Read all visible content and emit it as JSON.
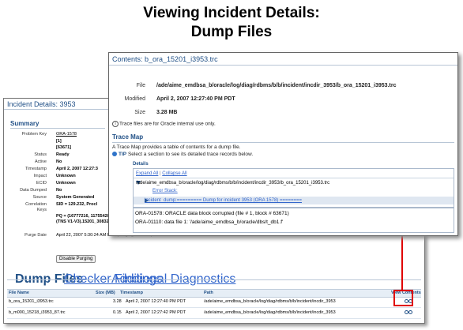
{
  "slide": {
    "title_line1": "Viewing Incident Details:",
    "title_line2": "Dump Files"
  },
  "incident": {
    "title": "Incident Details: 3953",
    "summary_heading": "Summary",
    "fields": [
      {
        "label": "Problem Key",
        "value": "ORA-1578",
        "style": "link"
      },
      {
        "label": "",
        "value": "[1]",
        "style": "bold"
      },
      {
        "label": "",
        "value": "[63671]",
        "style": "bold"
      },
      {
        "label": "Status",
        "value": "Ready",
        "style": "bold"
      },
      {
        "label": "Active",
        "value": "No",
        "style": "bold"
      },
      {
        "label": "Timestamp",
        "value": "April 2, 2007 12:27:3",
        "style": "bold"
      },
      {
        "label": "Impact",
        "value": "Unknown",
        "style": "bold"
      },
      {
        "label": "ECID",
        "value": "Unknown",
        "style": "bold"
      },
      {
        "label": "Data Dumped",
        "value": "No",
        "style": "bold"
      },
      {
        "label": "Source",
        "value": "System Generated",
        "style": "bold"
      },
      {
        "label": "Correlation",
        "value": "SID = 129.232, ProcI",
        "style": "bold"
      },
      {
        "label": "Keys",
        "value": "",
        "style": "plain"
      },
      {
        "label": "",
        "value": "PQ = (16777216, 1175542056), Client ProcId = oracle@stacg17",
        "style": "bold"
      },
      {
        "label": "",
        "value": "(TNS V1-V3).15201_3083220672",
        "style": "bold"
      },
      {
        "label": "Purge Date",
        "value": "April 22, 2007 5:30:24 AM PDT (Purging Enabled)",
        "style": "plain"
      }
    ],
    "disable_purging_label": "Disable Purging",
    "tabs": [
      "Dump Files",
      "Checker Findings",
      "Additional Diagnostics"
    ],
    "active_tab": "Dump Files",
    "table": {
      "headers": [
        "File Name",
        "Size (MB)",
        "Timestamp",
        "Path",
        "View Contents"
      ],
      "rows": [
        {
          "file": "b_ora_15201_i3953.trc",
          "size": "3.28",
          "timestamp": "April 2, 2007 12:27:40 PM PDT",
          "path": "/ade/aime_emdbsa_b/oracle/log/diag/rdbms/b/b/incident/incdir_3953",
          "view_icon": "glasses-icon"
        },
        {
          "file": "b_m000_15218_i3953_87.trc",
          "size": "0.15",
          "timestamp": "April 2, 2007 12:27:42 PM PDT",
          "path": "/ade/aime_emdbsa_b/oracle/log/diag/rdbms/b/b/incident/incdir_3953",
          "view_icon": "glasses-icon"
        }
      ]
    }
  },
  "contents": {
    "title": "Contents: b_ora_15201_i3953.trc",
    "file_label": "File",
    "file_value": "/ade/aime_emdbsa_b/oracle/log/diag/rdbms/b/b/incident/incdir_3953/b_ora_15201_i3953.trc",
    "modified_label": "Modified",
    "modified_value": "April 2, 2007 12:27:40 PM PDT",
    "size_label": "Size",
    "size_value": "3.28 MB",
    "note": "Trace files are for Oracle internal use only.",
    "trace_map_heading": "Trace Map",
    "trace_map_desc": "A Trace Map provides a table of contents for a dump file.",
    "tip_label": "TIP",
    "tip_text": "Select a section to see its detailed trace records below.",
    "details_heading": "Details",
    "expand_all": "Expand All",
    "collapse_all": "Collapse All",
    "tree_rows": [
      "/ade/aime_emdbsa_b/oracle/log/diag/rdbms/b/b/incident/incdir_3953/b_ora_15201_i3953.trc",
      "Error Stack:",
      "incident_dump:========= Dump for incident 3953 (ORA 1578) ========"
    ],
    "errors": [
      "ORA-01578: ORACLE data block corrupted (file # 1, block # 63671)",
      "ORA-01110: data file 1: '/ade/aime_emdbsa_b/oracle/dbs/t_db1.f'"
    ]
  },
  "colors": {
    "heading_blue": "#1f4f86",
    "link_blue": "#3366cc",
    "highlight_red": "#e00000"
  }
}
